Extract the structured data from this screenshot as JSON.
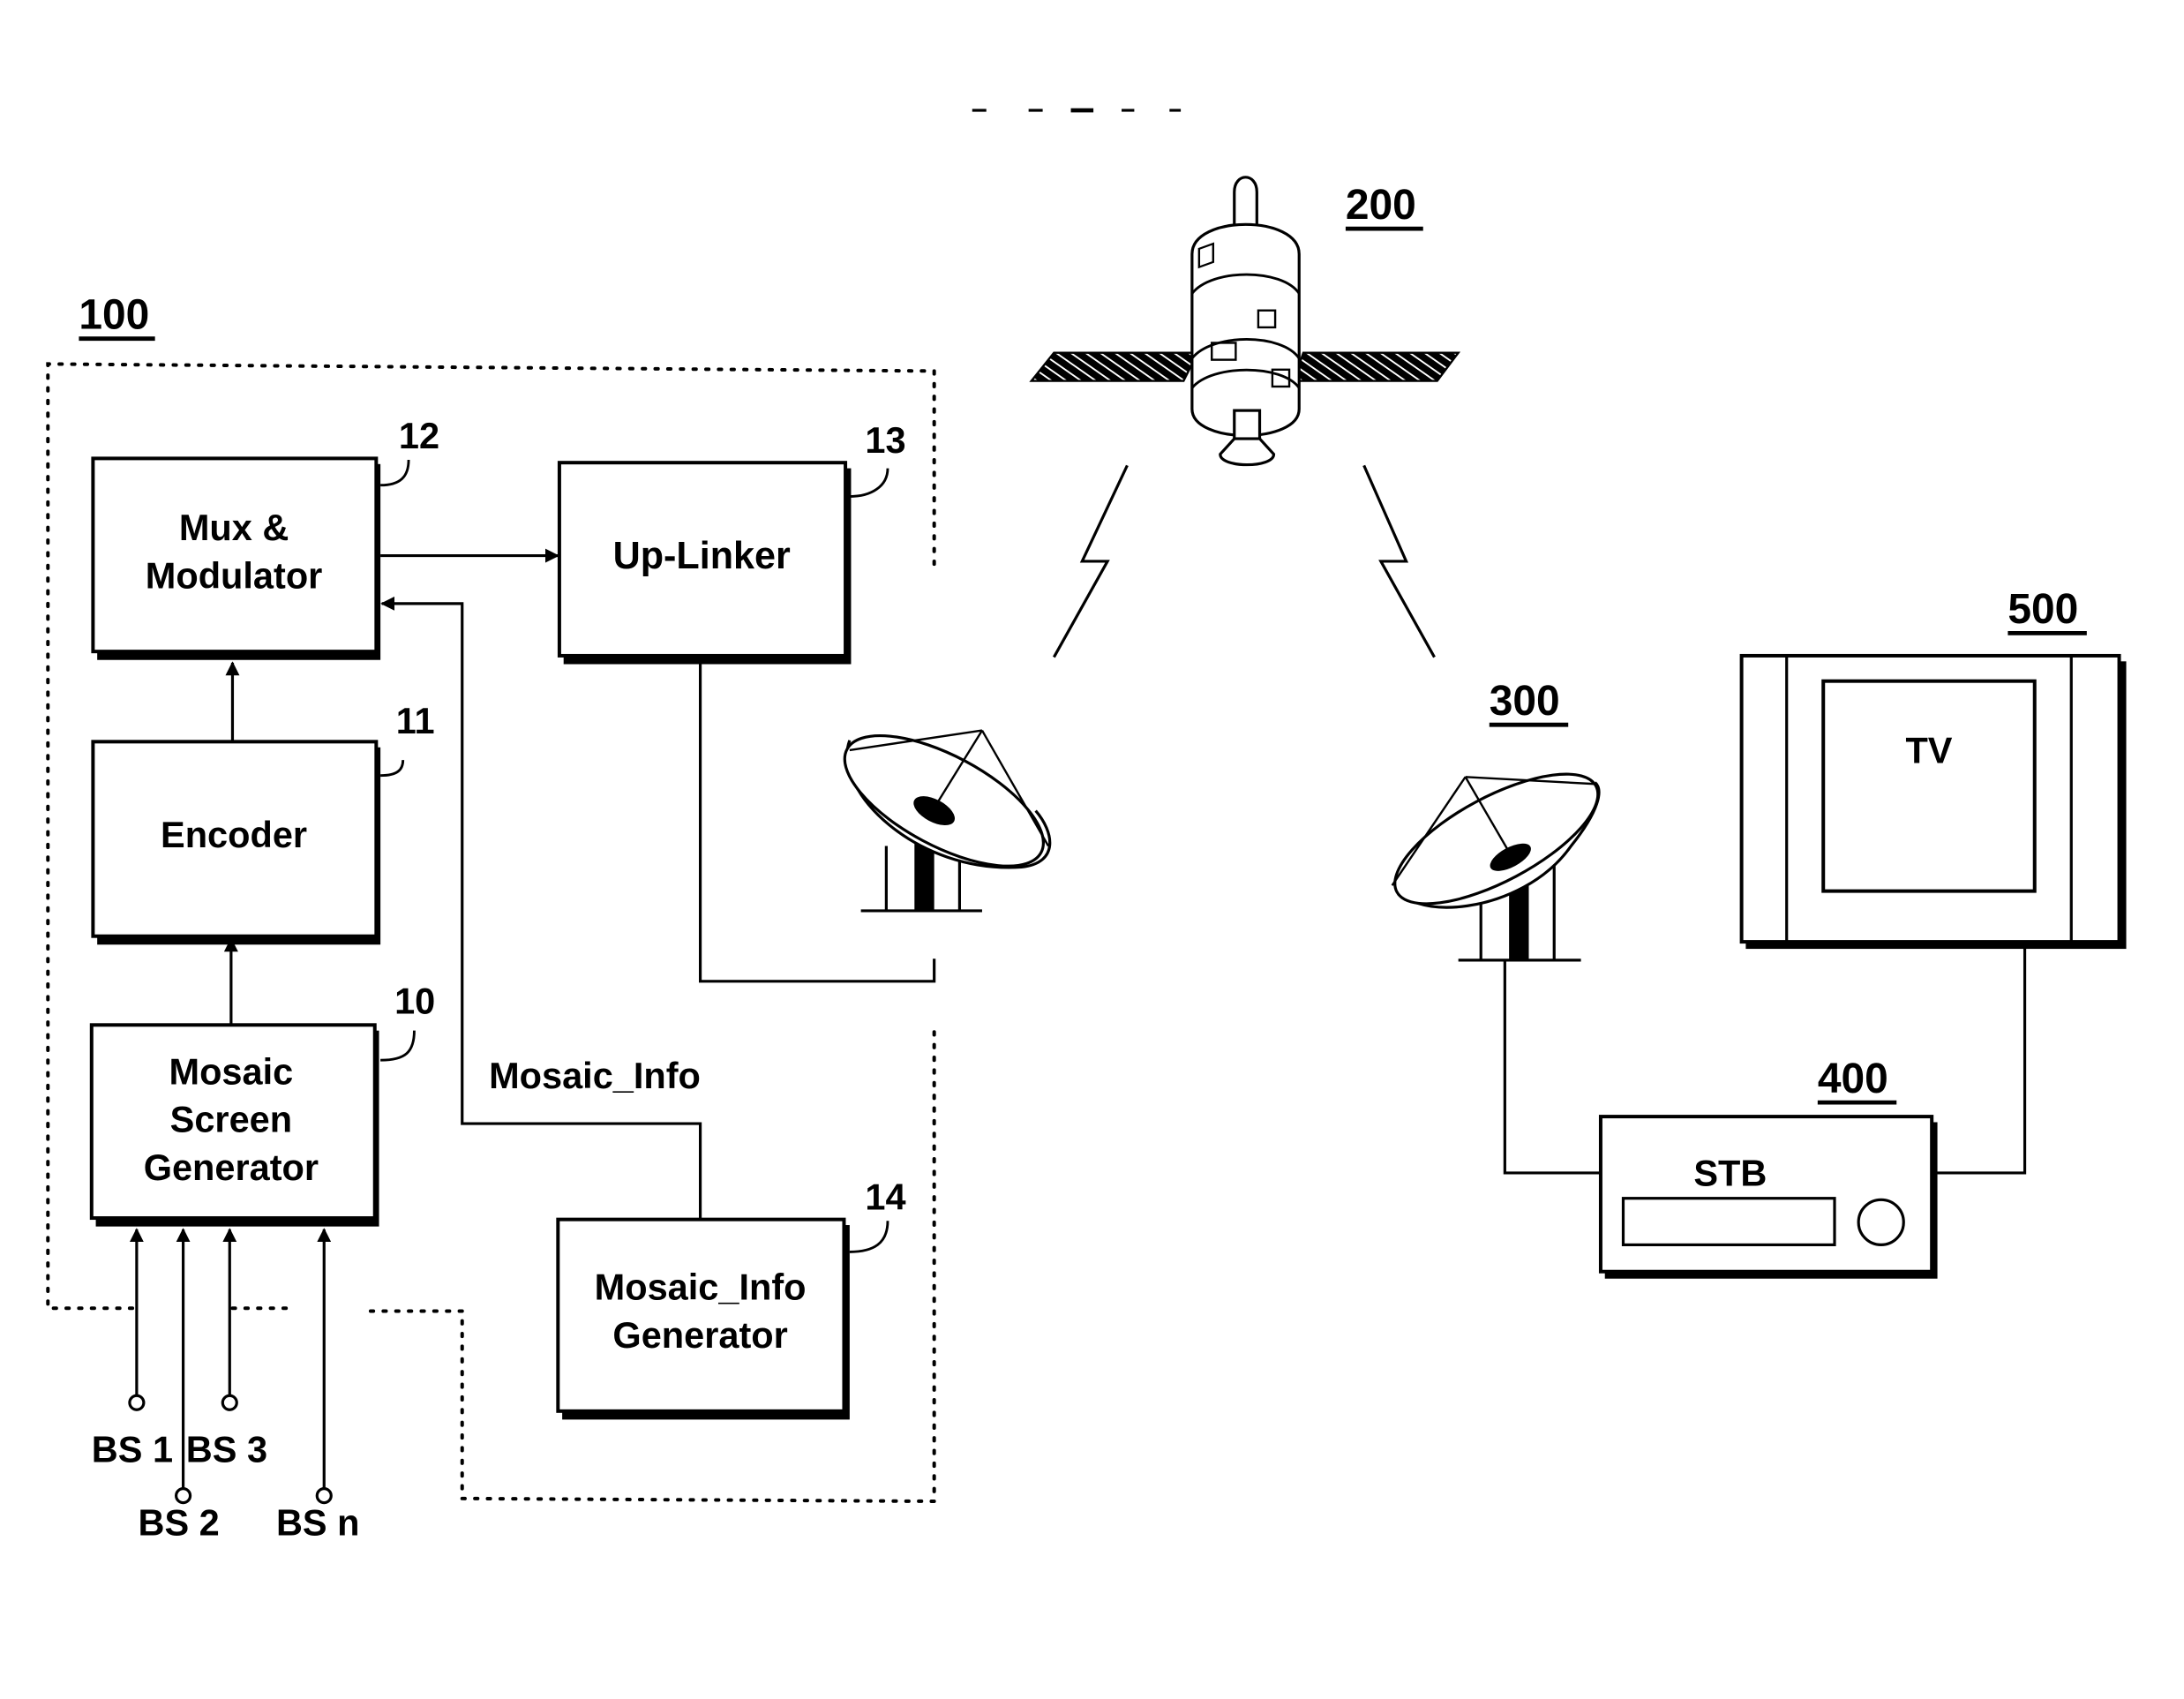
{
  "figure": {
    "system_label": "100",
    "satellite_label": "200",
    "receiver_antenna_label": "300",
    "stb_label": "400",
    "tv_label": "500"
  },
  "blocks": {
    "mux": {
      "ref": "12",
      "line1": "Mux &",
      "line2": "Modulator"
    },
    "uplinker": {
      "ref": "13",
      "line1": "Up-Linker"
    },
    "encoder": {
      "ref": "11",
      "line1": "Encoder"
    },
    "mosaic_screen_gen": {
      "ref": "10",
      "line1": "Mosaic",
      "line2": "Screen",
      "line3": "Generator"
    },
    "mosaic_info_gen": {
      "ref": "14",
      "line1": "Mosaic_Info",
      "line2": "Generator"
    }
  },
  "signals": {
    "mosaic_info": "Mosaic_Info"
  },
  "inputs": [
    "BS 1",
    "BS 2",
    "BS 3",
    "BS n"
  ],
  "devices": {
    "tv_screen_text": "TV",
    "stb_text": "STB"
  }
}
